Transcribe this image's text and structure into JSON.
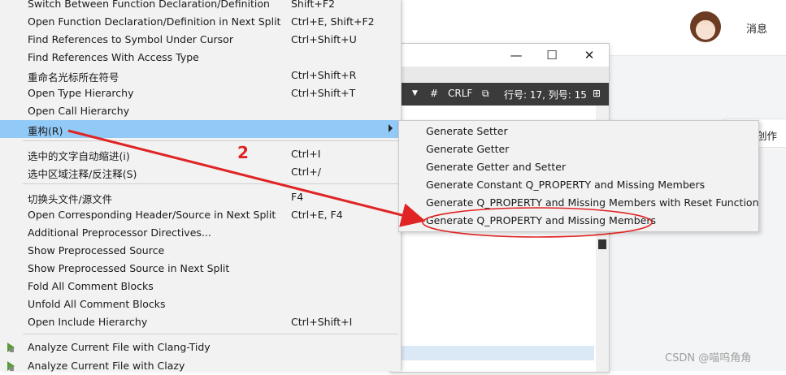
{
  "web": {
    "message_label": "消息",
    "side_text": "创作",
    "watermark": "CSDN @喵呜角角"
  },
  "editor": {
    "status": {
      "hash": "#",
      "line_ending": "CRLF",
      "position": "行号: 17, 列号: 15"
    }
  },
  "menu": {
    "items": [
      {
        "label": "Switch Between Function Declaration/Definition",
        "shortcut": "Shift+F2"
      },
      {
        "label": "Open Function Declaration/Definition in Next Split",
        "shortcut": "Ctrl+E, Shift+F2"
      },
      {
        "label": "Find References to Symbol Under Cursor",
        "shortcut": "Ctrl+Shift+U"
      },
      {
        "label": "Find References With Access Type",
        "shortcut": ""
      },
      {
        "label": "重命名光标所在符号",
        "shortcut": "Ctrl+Shift+R"
      },
      {
        "label": "Open Type Hierarchy",
        "shortcut": "Ctrl+Shift+T"
      },
      {
        "label": "Open Call Hierarchy",
        "shortcut": ""
      },
      {
        "label": "重构(R)",
        "shortcut": ""
      },
      {
        "label": "选中的文字自动缩进(i)",
        "shortcut": "Ctrl+I"
      },
      {
        "label": "选中区域注释/反注释(S)",
        "shortcut": "Ctrl+/"
      },
      {
        "label": "切换头文件/源文件",
        "shortcut": "F4"
      },
      {
        "label": "Open Corresponding Header/Source in Next Split",
        "shortcut": "Ctrl+E, F4"
      },
      {
        "label": "Additional Preprocessor Directives...",
        "shortcut": ""
      },
      {
        "label": "Show Preprocessed Source",
        "shortcut": ""
      },
      {
        "label": "Show Preprocessed Source in Next Split",
        "shortcut": ""
      },
      {
        "label": "Fold All Comment Blocks",
        "shortcut": ""
      },
      {
        "label": "Unfold All Comment Blocks",
        "shortcut": ""
      },
      {
        "label": "Open Include Hierarchy",
        "shortcut": "Ctrl+Shift+I"
      },
      {
        "label": "Analyze Current File with Clang-Tidy",
        "shortcut": ""
      },
      {
        "label": "Analyze Current File with Clazy",
        "shortcut": ""
      }
    ]
  },
  "submenu": {
    "items": [
      "Generate Setter",
      "Generate Getter",
      "Generate Getter and Setter",
      "Generate Constant Q_PROPERTY and Missing Members",
      "Generate Q_PROPERTY and Missing Members with Reset Function",
      "Generate Q_PROPERTY and Missing Members"
    ]
  },
  "annotation": {
    "step_number": "2",
    "color": "#e02424"
  },
  "colors": {
    "menu_bg": "#f2f2f2",
    "selected_bg": "#91c9f7",
    "status_bar": "#3b3b3b"
  }
}
